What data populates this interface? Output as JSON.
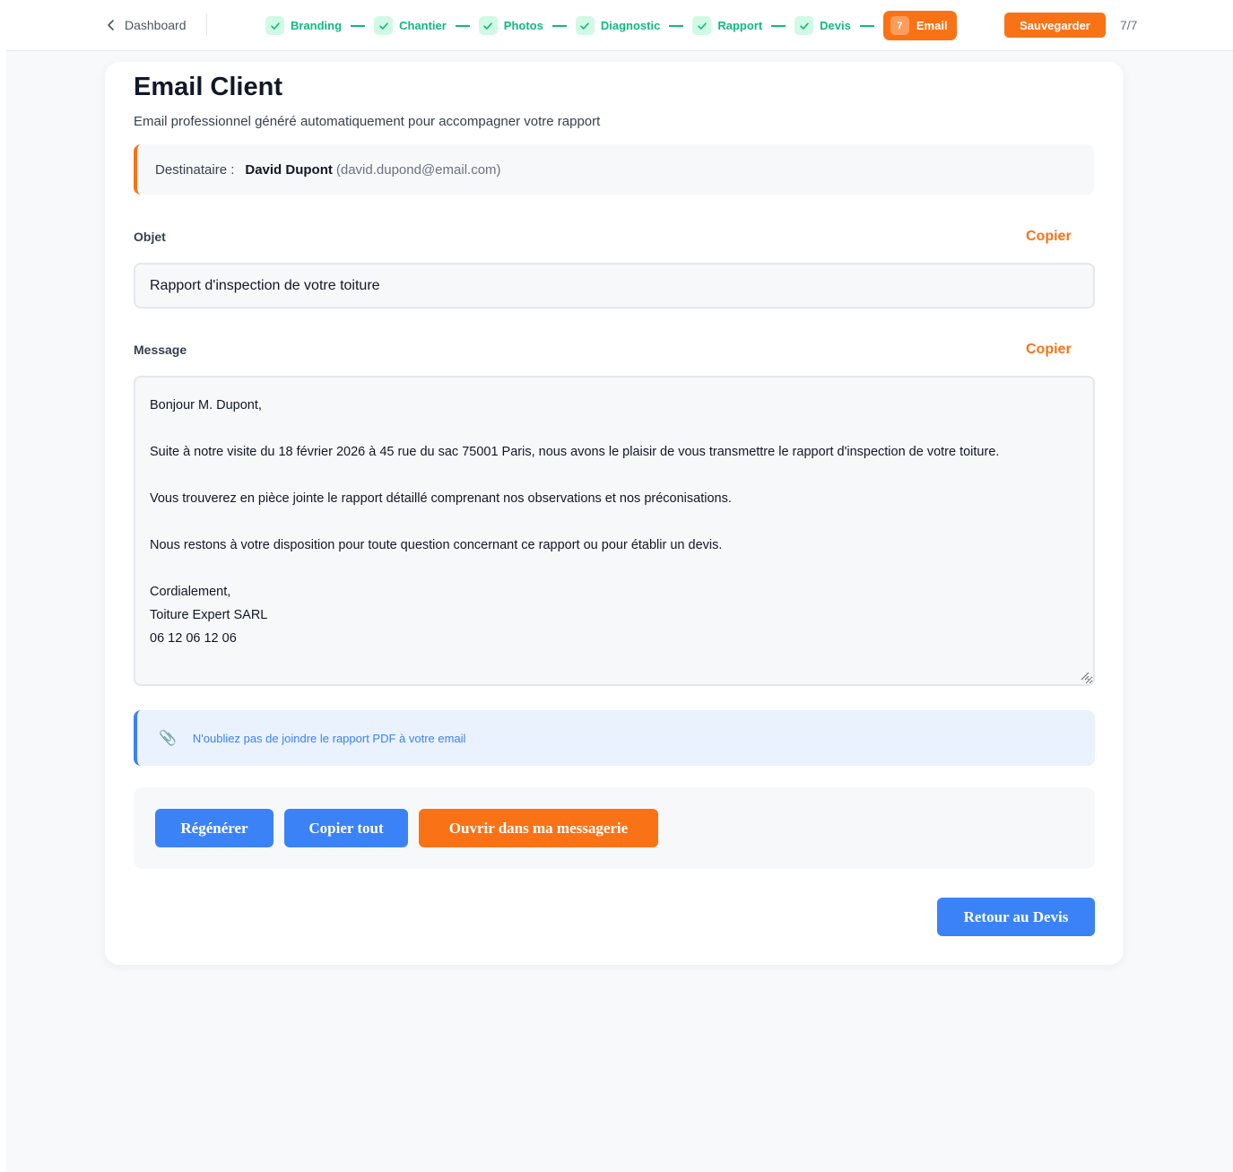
{
  "header": {
    "back_label": "Dashboard",
    "steps": [
      {
        "label": "Branding"
      },
      {
        "label": "Chantier"
      },
      {
        "label": "Photos"
      },
      {
        "label": "Diagnostic"
      },
      {
        "label": "Rapport"
      },
      {
        "label": "Devis"
      }
    ],
    "active_step": {
      "number": "7",
      "label": "Email"
    },
    "save_label": "Sauvegarder",
    "step_count": "7/7"
  },
  "page": {
    "title": "Email Client",
    "subtitle": "Email professionnel généré automatiquement pour accompagner votre rapport"
  },
  "recipient": {
    "label": "Destinataire :",
    "name": "David Dupont",
    "email": "(david.dupond@email.com)"
  },
  "subject": {
    "label": "Objet",
    "copy_label": "Copier",
    "value": "Rapport d'inspection de votre toiture"
  },
  "message": {
    "label": "Message",
    "copy_label": "Copier",
    "lines": [
      "Bonjour M. Dupont,",
      "",
      "Suite à notre visite du 18 février 2026 à 45 rue du sac 75001 Paris, nous avons le plaisir de vous transmettre le rapport d'inspection de votre toiture.",
      "",
      "Vous trouverez en pièce jointe le rapport détaillé comprenant nos observations et nos préconisations.",
      "",
      "Nous restons à votre disposition pour toute question concernant ce rapport ou pour établir un devis.",
      "",
      "Cordialement,",
      "Toiture Expert SARL",
      "06 12 06 12 06"
    ]
  },
  "note": {
    "icon": "paperclip-icon",
    "text": "N'oubliez pas de joindre le rapport PDF à votre email"
  },
  "actions": {
    "regenerate_label": "Régénérer",
    "copy_all_label": "Copier tout",
    "open_mail_label": "Ouvrir dans ma messagerie",
    "back_label": "Retour au Devis"
  },
  "colors": {
    "accent": "#f97316",
    "primary": "#3b82f6",
    "success": "#10b981"
  }
}
